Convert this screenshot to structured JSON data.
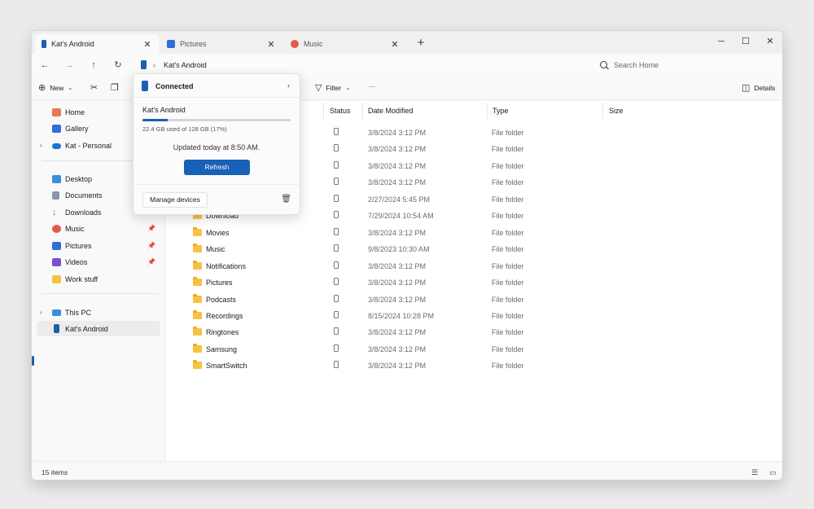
{
  "tabs": [
    {
      "label": "Kat's Android",
      "icon": "phone-icon",
      "active": true
    },
    {
      "label": "Pictures",
      "icon": "pictures-icon",
      "active": false
    },
    {
      "label": "Music",
      "icon": "music-icon",
      "active": false
    }
  ],
  "window_controls": {
    "minimize": "─",
    "maximize": "☐",
    "close": "✕"
  },
  "address": {
    "path": "Kat's Android",
    "separator": "›"
  },
  "search": {
    "placeholder": "Search Home"
  },
  "commands": {
    "new_label": "New",
    "filter_label": "Filter",
    "more": "···",
    "details_label": "Details"
  },
  "sidebar": {
    "items": [
      {
        "label": "Home",
        "icon": "home-icon"
      },
      {
        "label": "Gallery",
        "icon": "gallery-icon"
      },
      {
        "label": "Kat - Personal",
        "icon": "onedrive-icon"
      },
      {
        "label": "Desktop",
        "icon": "desktop-icon"
      },
      {
        "label": "Documents",
        "icon": "documents-icon"
      },
      {
        "label": "Downloads",
        "icon": "downloads-icon"
      },
      {
        "label": "Music",
        "icon": "music-icon"
      },
      {
        "label": "Pictures",
        "icon": "pictures-icon"
      },
      {
        "label": "Videos",
        "icon": "videos-icon"
      },
      {
        "label": "Work stuff",
        "icon": "folder-icon"
      },
      {
        "label": "This PC",
        "icon": "this-pc-icon"
      },
      {
        "label": "Kat's Android",
        "icon": "phone-icon"
      }
    ]
  },
  "columns": {
    "status": "Status",
    "date": "Date Modified",
    "type": "Type",
    "size": "Size"
  },
  "files": [
    {
      "name": "",
      "date": "3/8/2024 3:12 PM",
      "type": "File folder"
    },
    {
      "name": "",
      "date": "3/8/2024 3:12 PM",
      "type": "File folder"
    },
    {
      "name": "",
      "date": "3/8/2024 3:12 PM",
      "type": "File folder"
    },
    {
      "name": "",
      "date": "3/8/2024 3:12 PM",
      "type": "File folder"
    },
    {
      "name": "",
      "date": "2/27/2024 5:45 PM",
      "type": "File folder"
    },
    {
      "name": "Download",
      "date": "7/29/2024 10:54 AM",
      "type": "File folder"
    },
    {
      "name": "Movies",
      "date": "3/8/2024 3:12 PM",
      "type": "File folder"
    },
    {
      "name": "Music",
      "date": "9/8/2023 10:30 AM",
      "type": "File folder"
    },
    {
      "name": "Notifications",
      "date": "3/8/2024 3:12 PM",
      "type": "File folder"
    },
    {
      "name": "Pictures",
      "date": "3/8/2024 3:12 PM",
      "type": "File folder"
    },
    {
      "name": "Podcasts",
      "date": "3/8/2024 3:12 PM",
      "type": "File folder"
    },
    {
      "name": "Recordings",
      "date": "8/15/2024 10:28 PM",
      "type": "File folder"
    },
    {
      "name": "Ringtones",
      "date": "3/8/2024 3:12 PM",
      "type": "File folder"
    },
    {
      "name": "Samsung",
      "date": "3/8/2024 3:12 PM",
      "type": "File folder"
    },
    {
      "name": "SmartSwitch",
      "date": "3/8/2024 3:12 PM",
      "type": "File folder"
    }
  ],
  "status_bar": {
    "count": "15 items"
  },
  "popup": {
    "status": "Connected",
    "device_name": "Kat's Android",
    "usage_text": "22.4 GB used of 128 GB (17%)",
    "usage_percent": 17,
    "updated_text": "Updated today at 8:50 AM.",
    "refresh_label": "Refresh",
    "manage_label": "Manage devices"
  },
  "colors": {
    "accent": "#1960b7",
    "folder": "#f5c242"
  }
}
